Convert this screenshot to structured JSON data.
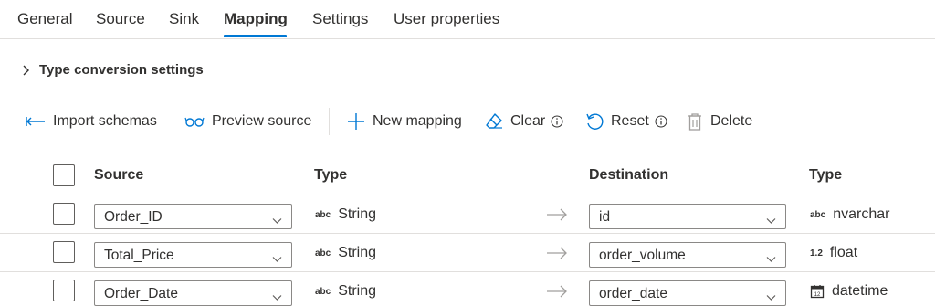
{
  "tabs": [
    {
      "label": "General"
    },
    {
      "label": "Source"
    },
    {
      "label": "Sink"
    },
    {
      "label": "Mapping",
      "active": true
    },
    {
      "label": "Settings"
    },
    {
      "label": "User properties"
    }
  ],
  "section": {
    "label": "Type conversion settings",
    "icon": "chevron-right-icon"
  },
  "toolbar": {
    "import": "Import schemas",
    "preview": "Preview source",
    "new": "New mapping",
    "clear": "Clear",
    "reset": "Reset",
    "delete": "Delete"
  },
  "columns": {
    "source": "Source",
    "type": "Type",
    "destination": "Destination",
    "dest_type": "Type"
  },
  "rows": [
    {
      "source": "Order_ID",
      "source_type_badge": "abc",
      "source_type": "String",
      "destination": "id",
      "dest_type_badge": "abc",
      "dest_type": "nvarchar"
    },
    {
      "source": "Total_Price",
      "source_type_badge": "abc",
      "source_type": "String",
      "destination": "order_volume",
      "dest_type_badge": "1.2",
      "dest_type": "float"
    },
    {
      "source": "Order_Date",
      "source_type_badge": "abc",
      "source_type": "String",
      "destination": "order_date",
      "dest_type_badge": "calendar-icon",
      "dest_type": "datetime"
    }
  ],
  "colors": {
    "accent": "#0078d4",
    "text": "#323130",
    "border": "#e1dfdd",
    "muted": "#a19f9d"
  }
}
